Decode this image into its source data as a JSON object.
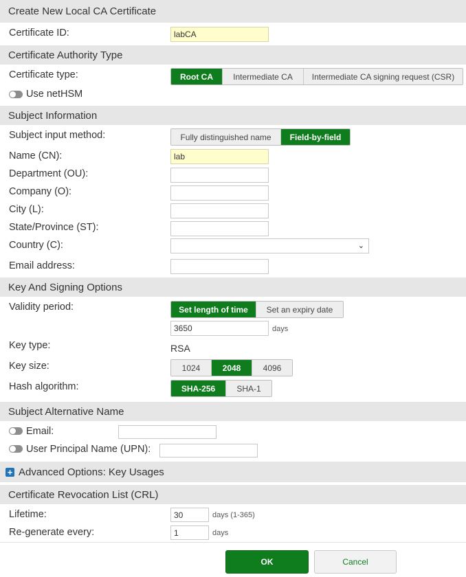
{
  "dialog": {
    "title": "Create New Local CA Certificate"
  },
  "cert_id": {
    "label": "Certificate ID:",
    "value": "labCA"
  },
  "ca_type": {
    "header": "Certificate Authority Type",
    "label": "Certificate type:",
    "options": [
      "Root CA",
      "Intermediate CA",
      "Intermediate CA signing request (CSR)"
    ],
    "selected": "Root CA",
    "nethsm_label": "Use netHSM"
  },
  "subject": {
    "header": "Subject Information",
    "method_label": "Subject input method:",
    "methods": [
      "Fully distinguished name",
      "Field-by-field"
    ],
    "method_selected": "Field-by-field",
    "name_label": "Name (CN):",
    "name_value": "lab",
    "dept_label": "Department (OU):",
    "company_label": "Company (O):",
    "city_label": "City (L):",
    "state_label": "State/Province (ST):",
    "country_label": "Country (C):",
    "email_label": "Email address:"
  },
  "key": {
    "header": "Key And Signing Options",
    "validity_label": "Validity period:",
    "validity_options": [
      "Set length of time",
      "Set an expiry date"
    ],
    "validity_selected": "Set length of time",
    "days_value": "3650",
    "days_unit": "days",
    "type_label": "Key type:",
    "type_value": "RSA",
    "size_label": "Key size:",
    "sizes": [
      "1024",
      "2048",
      "4096"
    ],
    "size_selected": "2048",
    "hash_label": "Hash algorithm:",
    "hashes": [
      "SHA-256",
      "SHA-1"
    ],
    "hash_selected": "SHA-256"
  },
  "san": {
    "header": "Subject Alternative Name",
    "email_label": "Email:",
    "upn_label": "User Principal Name (UPN):"
  },
  "advanced": {
    "label": "Advanced Options: Key Usages"
  },
  "crl": {
    "header": "Certificate Revocation List (CRL)",
    "lifetime_label": "Lifetime:",
    "lifetime_value": "30",
    "lifetime_unit": "days (1-365)",
    "regen_label": "Re-generate every:",
    "regen_value": "1",
    "regen_unit": "days"
  },
  "buttons": {
    "ok": "OK",
    "cancel": "Cancel"
  },
  "colors": {
    "accent": "#0f7d1e",
    "header_bg": "#e6e6e6",
    "highlight_input": "#fffdcc"
  }
}
